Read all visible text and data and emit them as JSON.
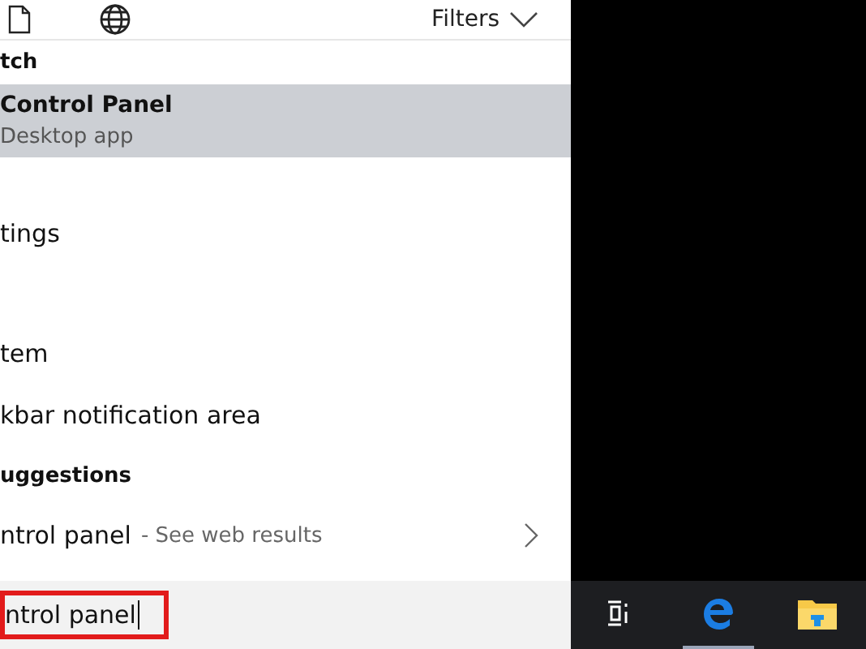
{
  "toolbar": {
    "filters": "Filters"
  },
  "results": [
    {
      "kind": "heading",
      "text": "tch"
    },
    {
      "kind": "app",
      "title": "Control Panel",
      "subtitle": "Desktop app",
      "selected": true
    },
    {
      "kind": "setting",
      "text": "tings"
    },
    {
      "kind": "setting",
      "text": "tem"
    },
    {
      "kind": "setting",
      "text": "kbar notification area"
    },
    {
      "kind": "heading",
      "text": "uggestions"
    },
    {
      "kind": "suggestion",
      "text": "ntrol panel",
      "hint": "- See web results"
    }
  ],
  "search": {
    "value": "ntrol panel",
    "outlined": true
  },
  "taskbar": [
    {
      "kind": "taskview",
      "selected": false
    },
    {
      "kind": "browser",
      "selected": true
    },
    {
      "kind": "folder",
      "selected": false
    }
  ]
}
